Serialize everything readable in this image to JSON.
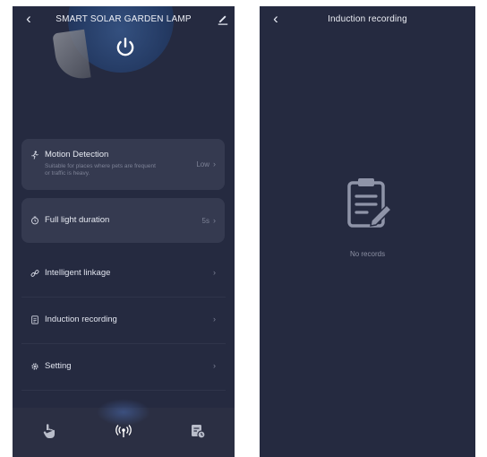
{
  "left_screen": {
    "title": "SMART SOLAR GARDEN LAMP",
    "cards": [
      {
        "label": "Motion Detection",
        "description": "Suitable for places where pets are frequent or traffic is heavy.",
        "value": "Low",
        "icon": "motion-icon"
      },
      {
        "label": "Full light duration",
        "value": "5s",
        "icon": "timer-icon"
      }
    ],
    "rows": [
      {
        "label": "Intelligent linkage",
        "icon": "link-icon"
      },
      {
        "label": "Induction recording",
        "icon": "record-icon"
      },
      {
        "label": "Setting",
        "icon": "gear-icon"
      }
    ],
    "tabs": [
      {
        "icon": "hand-pointer-icon"
      },
      {
        "icon": "radar-signal-icon"
      },
      {
        "icon": "schedule-icon"
      }
    ]
  },
  "right_screen": {
    "title": "Induction recording",
    "empty_text": "No records",
    "empty_icon": "clipboard-edit-icon"
  },
  "colors": {
    "background": "#252a40",
    "card": "#353a50",
    "bottom_bar": "#2b2f43"
  }
}
